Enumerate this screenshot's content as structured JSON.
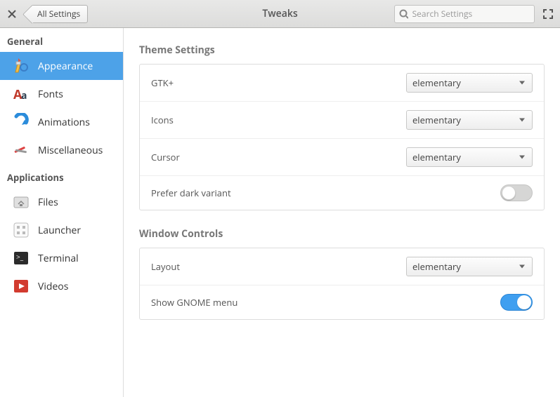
{
  "header": {
    "back_label": "All Settings",
    "title": "Tweaks",
    "search_placeholder": "Search Settings"
  },
  "sidebar": {
    "groups": [
      {
        "header": "General",
        "items": [
          {
            "label": "Appearance",
            "selected": true
          },
          {
            "label": "Fonts"
          },
          {
            "label": "Animations"
          },
          {
            "label": "Miscellaneous"
          }
        ]
      },
      {
        "header": "Applications",
        "items": [
          {
            "label": "Files"
          },
          {
            "label": "Launcher"
          },
          {
            "label": "Terminal"
          },
          {
            "label": "Videos"
          }
        ]
      }
    ]
  },
  "sections": {
    "theme": {
      "title": "Theme Settings",
      "rows": {
        "gtk": {
          "label": "GTK+",
          "value": "elementary"
        },
        "icons": {
          "label": "Icons",
          "value": "elementary"
        },
        "cursor": {
          "label": "Cursor",
          "value": "elementary"
        },
        "dark": {
          "label": "Prefer dark variant",
          "value": false
        }
      }
    },
    "window": {
      "title": "Window Controls",
      "rows": {
        "layout": {
          "label": "Layout",
          "value": "elementary"
        },
        "gnome": {
          "label": "Show GNOME menu",
          "value": true
        }
      }
    }
  }
}
